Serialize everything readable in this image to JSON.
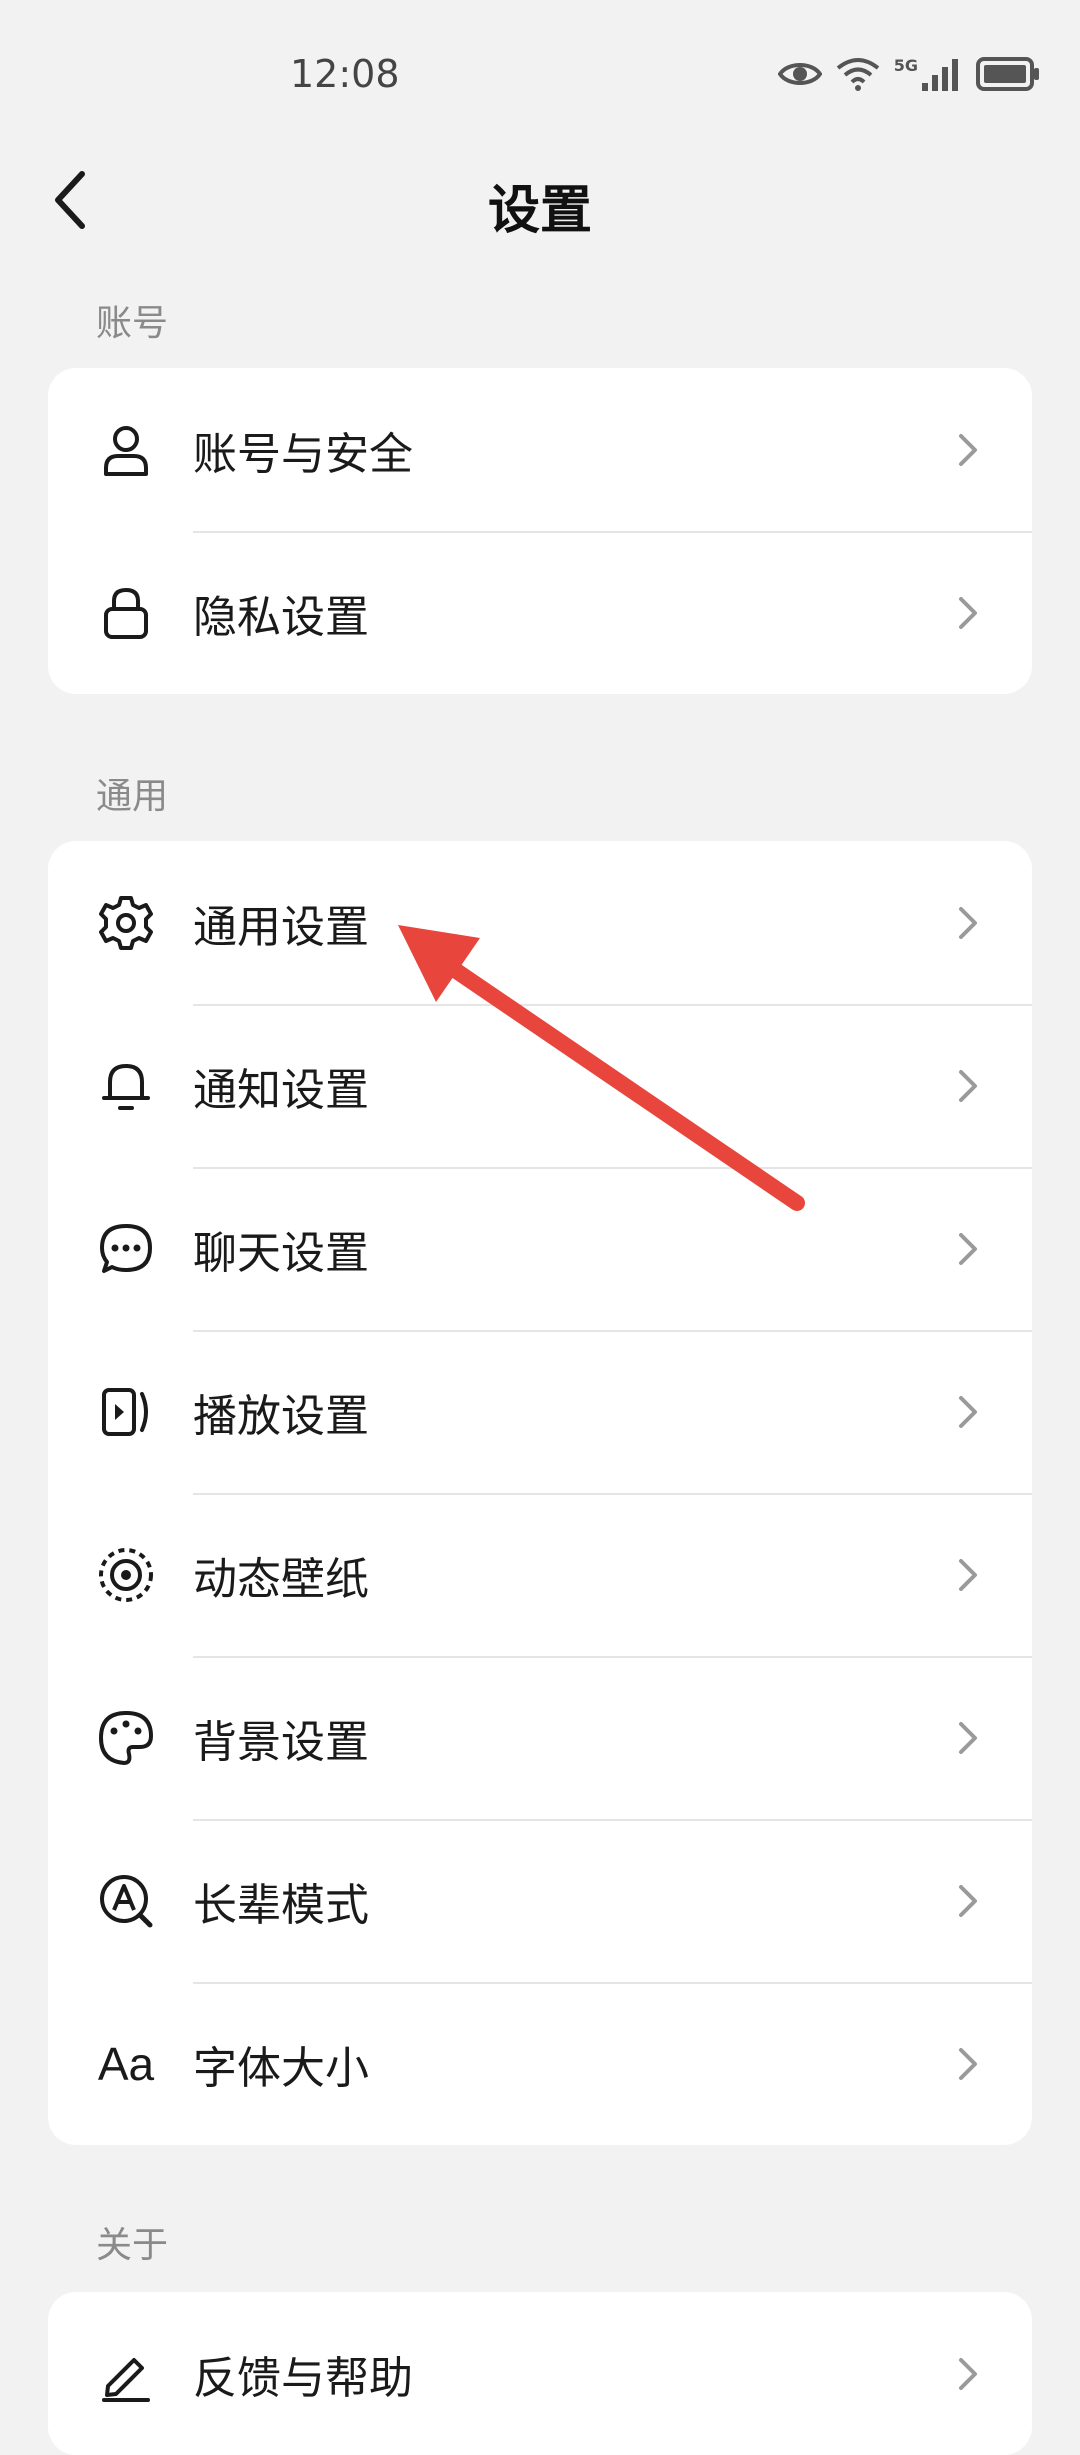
{
  "status_bar": {
    "time": "12:08",
    "network": "5G",
    "icons": [
      "eye-icon",
      "wifi-icon",
      "signal-icon",
      "battery-icon"
    ]
  },
  "header": {
    "title": "设置",
    "back_icon": "chevron-left-icon"
  },
  "sections": {
    "account": {
      "label": "账号",
      "items": [
        {
          "label": "账号与安全",
          "icon": "user-icon"
        },
        {
          "label": "隐私设置",
          "icon": "lock-icon"
        }
      ]
    },
    "general": {
      "label": "通用",
      "items": [
        {
          "label": "通用设置",
          "icon": "gear-icon"
        },
        {
          "label": "通知设置",
          "icon": "bell-icon"
        },
        {
          "label": "聊天设置",
          "icon": "chat-icon"
        },
        {
          "label": "播放设置",
          "icon": "play-icon"
        },
        {
          "label": "动态壁纸",
          "icon": "live-wallpaper-icon"
        },
        {
          "label": "背景设置",
          "icon": "palette-icon"
        },
        {
          "label": "长辈模式",
          "icon": "elder-mode-icon"
        },
        {
          "label": "字体大小",
          "icon": "font-size-icon",
          "icon_text": "Aa"
        }
      ]
    },
    "about": {
      "label": "关于",
      "items": [
        {
          "label": "反馈与帮助",
          "icon": "edit-icon"
        }
      ]
    }
  },
  "colors": {
    "background": "#f2f2f2",
    "card": "#ffffff",
    "annotation_arrow": "#e8453c"
  }
}
